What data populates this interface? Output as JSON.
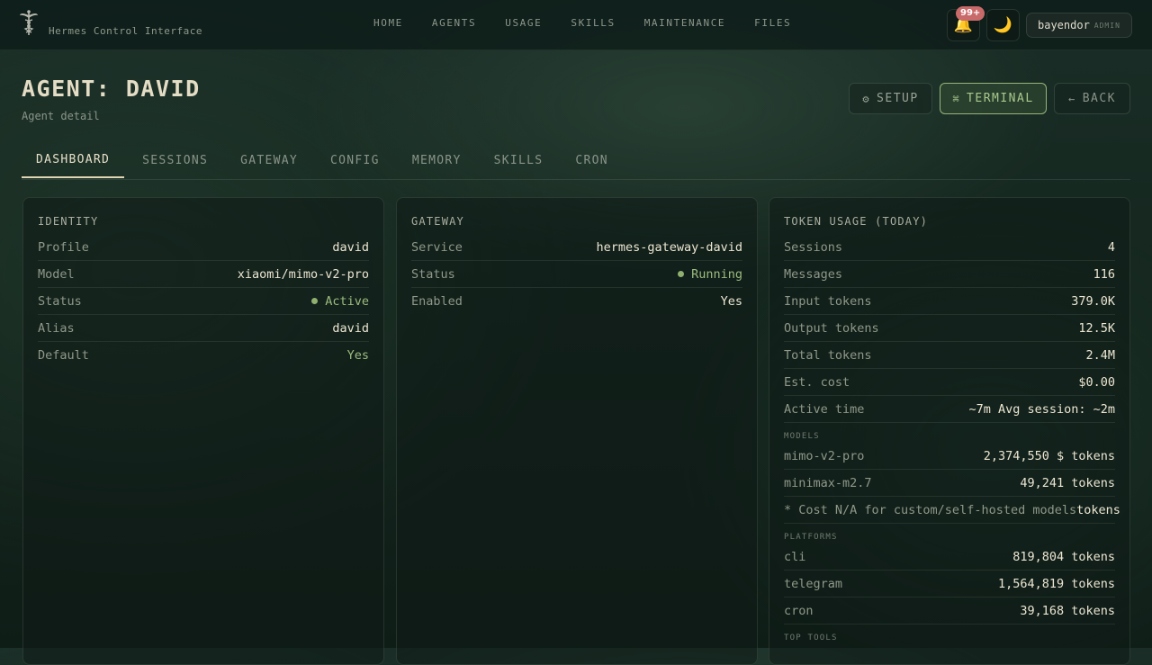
{
  "app": {
    "brand": "Hermes Control Interface"
  },
  "nav": [
    "HOME",
    "AGENTS",
    "USAGE",
    "SKILLS",
    "MAINTENANCE",
    "FILES"
  ],
  "notifications": {
    "badge": "99+"
  },
  "user": {
    "name": "bayendor",
    "role": "ADMIN"
  },
  "page": {
    "title": "AGENT: DAVID",
    "subtitle": "Agent detail"
  },
  "actions": {
    "setup": "SETUP",
    "terminal": "TERMINAL",
    "back": "BACK"
  },
  "tabs": [
    "DASHBOARD",
    "SESSIONS",
    "GATEWAY",
    "CONFIG",
    "MEMORY",
    "SKILLS",
    "CRON"
  ],
  "active_tab": "DASHBOARD",
  "identity": {
    "title": "IDENTITY",
    "rows": [
      {
        "label": "Profile",
        "value": "david"
      },
      {
        "label": "Model",
        "value": "xiaomi/mimo-v2-pro"
      },
      {
        "label": "Status",
        "value": "Active"
      },
      {
        "label": "Alias",
        "value": "david"
      },
      {
        "label": "Default",
        "value": "Yes"
      }
    ]
  },
  "gateway": {
    "title": "GATEWAY",
    "rows": [
      {
        "label": "Service",
        "value": "hermes-gateway-david"
      },
      {
        "label": "Status",
        "value": "Running"
      },
      {
        "label": "Enabled",
        "value": "Yes"
      }
    ]
  },
  "token_usage": {
    "title": "TOKEN USAGE (TODAY)",
    "rows": [
      {
        "label": "Sessions",
        "value": "4"
      },
      {
        "label": "Messages",
        "value": "116"
      },
      {
        "label": "Input tokens",
        "value": "379.0K"
      },
      {
        "label": "Output tokens",
        "value": "12.5K"
      },
      {
        "label": "Total tokens",
        "value": "2.4M"
      },
      {
        "label": "Est. cost",
        "value": "$0.00"
      },
      {
        "label": "Active time",
        "value": "~7m Avg session: ~2m"
      }
    ],
    "models_header": "MODELS",
    "models": [
      {
        "label": "mimo-v2-pro",
        "value": "2,374,550 $ tokens"
      },
      {
        "label": "minimax-m2.7",
        "value": "49,241 tokens"
      },
      {
        "label": "* Cost N/A for custom/self-hosted models",
        "value": "tokens"
      }
    ],
    "platforms_header": "PLATFORMS",
    "platforms": [
      {
        "label": "cli",
        "value": "819,804 tokens"
      },
      {
        "label": "telegram",
        "value": "1,564,819 tokens"
      },
      {
        "label": "cron",
        "value": "39,168 tokens"
      }
    ],
    "tools_header": "TOP TOOLS"
  },
  "colors": {
    "accent": "#a9c88c",
    "status_green": "#8fb06f",
    "badge": "#c96a6a"
  }
}
